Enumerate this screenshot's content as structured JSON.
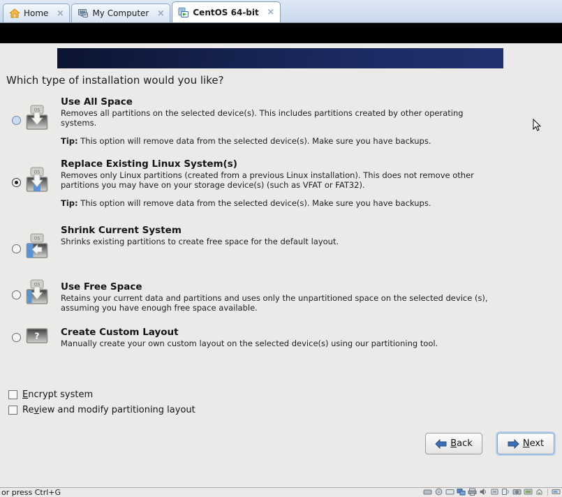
{
  "window": {
    "tabs": [
      {
        "label": "Home",
        "icon": "home-icon",
        "close": "×",
        "active": false
      },
      {
        "label": "My Computer",
        "icon": "computer-icon",
        "close": "×",
        "active": false
      },
      {
        "label": "CentOS 64-bit",
        "icon": "virtual-machine-icon",
        "close": "×",
        "active": true
      }
    ]
  },
  "installer": {
    "question": "Which type of installation would you like?",
    "options": [
      {
        "title": "Use All Space",
        "description": "Removes all partitions on the selected device(s).  This includes partitions created by other operating systems.",
        "tip_label": "Tip:",
        "tip_text": "This option will remove data from the selected device(s).  Make sure you have backups.",
        "selected": false,
        "icon": "use-all-space-icon",
        "icon_badge": "OS"
      },
      {
        "title": "Replace Existing Linux System(s)",
        "description": "Removes only Linux partitions (created from a previous Linux installation).  This does not remove other partitions you may have on your storage device(s) (such as VFAT or FAT32).",
        "tip_label": "Tip:",
        "tip_text": "This option will remove data from the selected device(s).  Make sure you have backups.",
        "selected": true,
        "icon": "replace-existing-linux-icon",
        "icon_badge": "OS"
      },
      {
        "title": "Shrink Current System",
        "description": "Shrinks existing partitions to create free space for the default layout.",
        "tip_label": "",
        "tip_text": "",
        "selected": false,
        "icon": "shrink-current-system-icon",
        "icon_badge": "OS"
      },
      {
        "title": "Use Free Space",
        "description": "Retains your current data and partitions and uses only the unpartitioned space on the selected device (s), assuming you have enough free space available.",
        "tip_label": "",
        "tip_text": "",
        "selected": false,
        "icon": "use-free-space-icon",
        "icon_badge": "OS"
      },
      {
        "title": "Create Custom Layout",
        "description": "Manually create your own custom layout on the selected device(s) using our partitioning tool.",
        "tip_label": "",
        "tip_text": "",
        "selected": false,
        "icon": "create-custom-layout-icon",
        "icon_badge": "?"
      }
    ],
    "checkboxes": [
      {
        "mnemonic": "E",
        "rest": "ncrypt system",
        "checked": false
      },
      {
        "mnemonic_prefix": "Re",
        "mnemonic": "v",
        "rest": "iew and modify partitioning layout",
        "checked": false
      }
    ],
    "buttons": {
      "back": {
        "mnemonic_prefix": "",
        "mnemonic": "B",
        "rest": "ack",
        "icon": "arrow-left-icon",
        "focused": false
      },
      "next": {
        "mnemonic_prefix": "",
        "mnemonic": "N",
        "rest": "ext",
        "icon": "arrow-right-icon",
        "focused": true
      }
    }
  },
  "status": {
    "text": "or press Ctrl+G",
    "devices": [
      "hard-disk-icon",
      "cd-dvd-icon",
      "floppy-icon",
      "network-icon",
      "printer-icon",
      "sound-icon",
      "usb-icon",
      "bluetooth-icon",
      "camera-icon",
      "display-icon",
      "battery-icon",
      "power-icon"
    ]
  },
  "colors": {
    "banner_dark": "#0b1430",
    "banner_light": "#22306e",
    "background": "#ebeae8",
    "accent_blue": "#2f6ab5"
  }
}
